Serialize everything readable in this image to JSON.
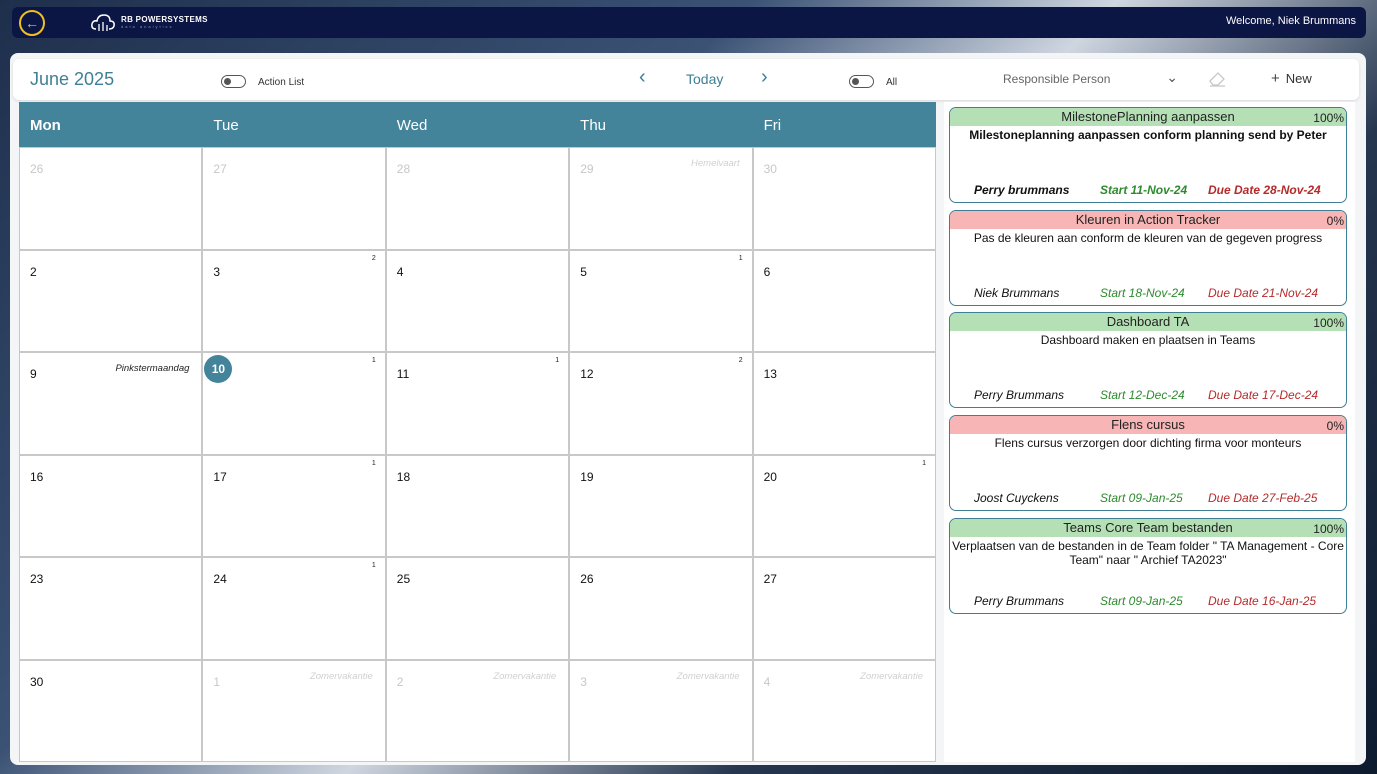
{
  "topbar": {
    "logo_name": "RB POWERSYSTEMS",
    "logo_tagline": "data analytics",
    "welcome": "Welcome, Niek Brummans"
  },
  "toolbar": {
    "month": "June 2025",
    "action_list_label": "Action List",
    "today_label": "Today",
    "all_label": "All",
    "responsible_placeholder": "Responsible Person",
    "new_label": "New"
  },
  "calendar": {
    "weekdays": [
      "Mon",
      "Tue",
      "Wed",
      "Thu",
      "Fri"
    ],
    "today": "10",
    "days": [
      {
        "num": "26",
        "muted": true,
        "holiday": "",
        "count": ""
      },
      {
        "num": "27",
        "muted": true,
        "holiday": "",
        "count": ""
      },
      {
        "num": "28",
        "muted": true,
        "holiday": "",
        "count": ""
      },
      {
        "num": "29",
        "muted": true,
        "holiday": "Hemelvaart",
        "count": ""
      },
      {
        "num": "30",
        "muted": true,
        "holiday": "",
        "count": ""
      },
      {
        "num": "2",
        "muted": false,
        "holiday": "",
        "count": ""
      },
      {
        "num": "3",
        "muted": false,
        "holiday": "",
        "count": "2"
      },
      {
        "num": "4",
        "muted": false,
        "holiday": "",
        "count": ""
      },
      {
        "num": "5",
        "muted": false,
        "holiday": "",
        "count": "1"
      },
      {
        "num": "6",
        "muted": false,
        "holiday": "",
        "count": ""
      },
      {
        "num": "9",
        "muted": false,
        "holiday": "Pinkstermaandag",
        "count": ""
      },
      {
        "num": "10",
        "muted": false,
        "holiday": "",
        "count": "1"
      },
      {
        "num": "11",
        "muted": false,
        "holiday": "",
        "count": "1"
      },
      {
        "num": "12",
        "muted": false,
        "holiday": "",
        "count": "2"
      },
      {
        "num": "13",
        "muted": false,
        "holiday": "",
        "count": ""
      },
      {
        "num": "16",
        "muted": false,
        "holiday": "",
        "count": ""
      },
      {
        "num": "17",
        "muted": false,
        "holiday": "",
        "count": "1"
      },
      {
        "num": "18",
        "muted": false,
        "holiday": "",
        "count": ""
      },
      {
        "num": "19",
        "muted": false,
        "holiday": "",
        "count": ""
      },
      {
        "num": "20",
        "muted": false,
        "holiday": "",
        "count": "1"
      },
      {
        "num": "23",
        "muted": false,
        "holiday": "",
        "count": ""
      },
      {
        "num": "24",
        "muted": false,
        "holiday": "",
        "count": "1"
      },
      {
        "num": "25",
        "muted": false,
        "holiday": "",
        "count": ""
      },
      {
        "num": "26",
        "muted": false,
        "holiday": "",
        "count": ""
      },
      {
        "num": "27",
        "muted": false,
        "holiday": "",
        "count": ""
      },
      {
        "num": "30",
        "muted": false,
        "holiday": "",
        "count": ""
      },
      {
        "num": "1",
        "muted": true,
        "holiday": "Zomervakantie",
        "count": ""
      },
      {
        "num": "2",
        "muted": true,
        "holiday": "Zomervakantie",
        "count": ""
      },
      {
        "num": "3",
        "muted": true,
        "holiday": "Zomervakantie",
        "count": ""
      },
      {
        "num": "4",
        "muted": true,
        "holiday": "Zomervakantie",
        "count": ""
      }
    ]
  },
  "tasks": [
    {
      "title": "MilestonePlanning aanpassen",
      "percent": "100%",
      "status": "green",
      "description": "Milestoneplanning aanpassen conform planning send by Peter",
      "person": "Perry brummans",
      "start": "Start  11-Nov-24",
      "due": "Due Date  28-Nov-24",
      "bold": true
    },
    {
      "title": "Kleuren in Action Tracker",
      "percent": "0%",
      "status": "red",
      "description": "Pas de kleuren aan conform de kleuren van de gegeven progress",
      "person": "Niek Brummans",
      "start": "Start  18-Nov-24",
      "due": "Due Date  21-Nov-24",
      "bold": false
    },
    {
      "title": "Dashboard TA",
      "percent": "100%",
      "status": "green",
      "description": "Dashboard maken en plaatsen in Teams",
      "person": "Perry Brummans",
      "start": "Start  12-Dec-24",
      "due": "Due Date  17-Dec-24",
      "bold": false
    },
    {
      "title": "Flens cursus",
      "percent": "0%",
      "status": "red",
      "description": "Flens cursus verzorgen door dichting firma voor monteurs",
      "person": "Joost Cuyckens",
      "start": "Start  09-Jan-25",
      "due": "Due Date  27-Feb-25",
      "bold": false
    },
    {
      "title": "Teams Core Team bestanden",
      "percent": "100%",
      "status": "green",
      "description": "Verplaatsen van de bestanden  in de Team folder \" TA Management - Core Team\" naar \" Archief TA2023\"",
      "person": "Perry Brummans",
      "start": "Start  09-Jan-25",
      "due": "Due Date  16-Jan-25",
      "bold": false
    }
  ],
  "colors": {
    "accent": "#43849a",
    "topbar": "#0b1644",
    "done": "#b5e0b5",
    "open": "#f7b5b5"
  }
}
